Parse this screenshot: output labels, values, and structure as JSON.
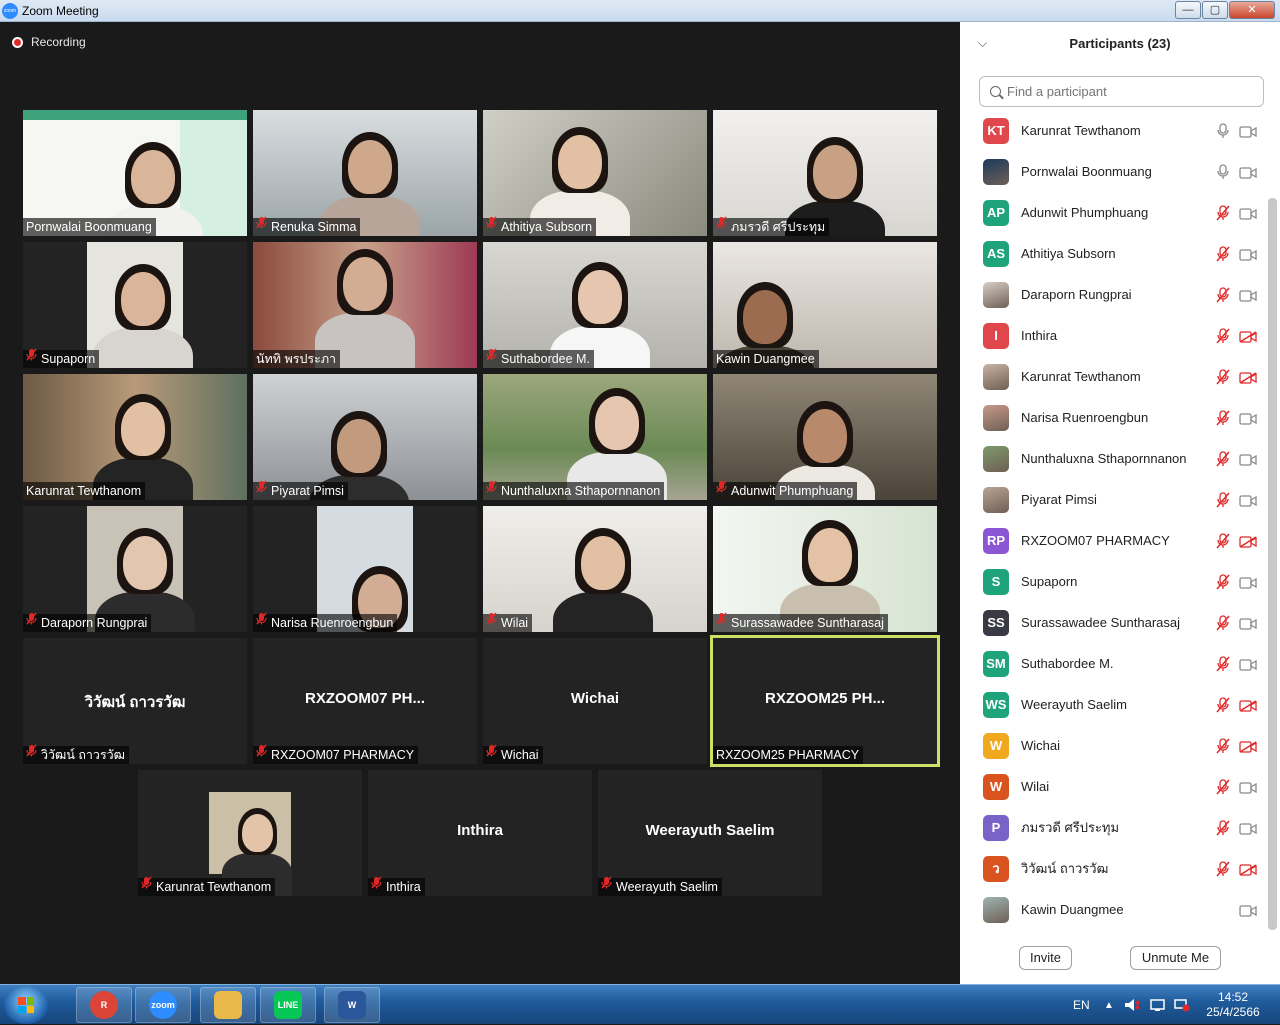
{
  "window": {
    "title": "Zoom Meeting",
    "minimize": "—",
    "maximize": "▢",
    "close": "✕"
  },
  "recording": {
    "label": "Recording"
  },
  "video_grid": {
    "tiles": [
      {
        "name": "Pornwalai Boonmuang",
        "muted": false
      },
      {
        "name": "Renuka Simma",
        "muted": true
      },
      {
        "name": "Athitiya Subsorn",
        "muted": true
      },
      {
        "name": "ภมรวดี ศรีประทุม",
        "muted": true
      },
      {
        "name": "Supaporn",
        "muted": true
      },
      {
        "name": "นัททิ พรประภา",
        "muted": false
      },
      {
        "name": "Suthabordee M.",
        "muted": true
      },
      {
        "name": "Kawin Duangmee",
        "muted": false
      },
      {
        "name": "Karunrat Tewthanom",
        "muted": false
      },
      {
        "name": "Piyarat Pimsi",
        "muted": true
      },
      {
        "name": "Nunthaluxna Sthapornnanon",
        "muted": true
      },
      {
        "name": "Adunwit Phumphuang",
        "muted": true
      },
      {
        "name": "Daraporn Rungprai",
        "muted": true
      },
      {
        "name": "Narisa Ruenroengbun",
        "muted": true
      },
      {
        "name": "Wilai",
        "muted": true
      },
      {
        "name": "Surassawadee Suntharasaj",
        "muted": true
      },
      {
        "name": "วิวัฒน์ ถาวรวัฒ",
        "display": "วิวัฒน์ ถาวรวัฒ",
        "muted": true
      },
      {
        "name": "RXZOOM07 PHARMACY",
        "display": "RXZOOM07  PH...",
        "muted": true
      },
      {
        "name": "Wichai",
        "display": "Wichai",
        "muted": true
      },
      {
        "name": "RXZOOM25 PHARMACY",
        "display": "RXZOOM25  PH...",
        "muted": false,
        "active": true
      },
      {
        "name": "Karunrat Tewthanom",
        "muted": true
      },
      {
        "name": "Inthira",
        "display": "Inthira",
        "muted": true
      },
      {
        "name": "Weerayuth Saelim",
        "display": "Weerayuth Saelim",
        "muted": true
      }
    ]
  },
  "participants_panel": {
    "title": "Participants (23)",
    "search_placeholder": "Find a participant",
    "participants": [
      {
        "initials": "KT",
        "name": "Karunrat Tewthanom",
        "color": "#e0474c",
        "mic": "on",
        "cam": "on"
      },
      {
        "initials": "",
        "name": "Pornwalai Boonmuang",
        "color": "#1b3a5c",
        "mic": "on",
        "cam": "on",
        "photo": true
      },
      {
        "initials": "AP",
        "name": "Adunwit Phumphuang",
        "color": "#1fa37a",
        "mic": "muted",
        "cam": "on"
      },
      {
        "initials": "AS",
        "name": "Athitiya Subsorn",
        "color": "#1fa37a",
        "mic": "muted",
        "cam": "on"
      },
      {
        "initials": "",
        "name": "Daraporn Rungprai",
        "color": "#d8cfc8",
        "mic": "muted",
        "cam": "on",
        "photo": true
      },
      {
        "initials": "I",
        "name": "Inthira",
        "color": "#e0474c",
        "mic": "muted",
        "cam": "off"
      },
      {
        "initials": "",
        "name": "Karunrat Tewthanom",
        "color": "#c9b3a3",
        "mic": "muted",
        "cam": "off",
        "photo": true
      },
      {
        "initials": "",
        "name": "Narisa Ruenroengbun",
        "color": "#c89a8a",
        "mic": "muted",
        "cam": "on",
        "photo": true
      },
      {
        "initials": "",
        "name": "Nunthaluxna Sthapornnanon",
        "color": "#7d9a6b",
        "mic": "muted",
        "cam": "on",
        "photo": true
      },
      {
        "initials": "",
        "name": "Piyarat Pimsi",
        "color": "#b9a596",
        "mic": "muted",
        "cam": "on",
        "photo": true
      },
      {
        "initials": "RP",
        "name": "RXZOOM07 PHARMACY",
        "color": "#8c55d4",
        "mic": "muted",
        "cam": "off"
      },
      {
        "initials": "S",
        "name": "Supaporn",
        "color": "#1fa37a",
        "mic": "muted",
        "cam": "on"
      },
      {
        "initials": "SS",
        "name": "Surassawadee Suntharasaj",
        "color": "#3a3a44",
        "mic": "muted",
        "cam": "on"
      },
      {
        "initials": "SM",
        "name": "Suthabordee M.",
        "color": "#1fa37a",
        "mic": "muted",
        "cam": "on"
      },
      {
        "initials": "WS",
        "name": "Weerayuth Saelim",
        "color": "#1fa37a",
        "mic": "muted",
        "cam": "off"
      },
      {
        "initials": "W",
        "name": "Wichai",
        "color": "#f0a81e",
        "mic": "muted",
        "cam": "off"
      },
      {
        "initials": "W",
        "name": "Wilai",
        "color": "#d9531e",
        "mic": "muted",
        "cam": "on"
      },
      {
        "initials": "P",
        "name": "ภมรวดี ศรีประทุม",
        "color": "#7b62c8",
        "mic": "muted",
        "cam": "on"
      },
      {
        "initials": "ว",
        "name": "วิวัฒน์ ถาวรวัฒ",
        "color": "#d9531e",
        "mic": "muted",
        "cam": "off"
      },
      {
        "initials": "",
        "name": "Kawin Duangmee",
        "color": "#9fb3b0",
        "mic": "none",
        "cam": "on",
        "photo": true
      }
    ],
    "invite_label": "Invite",
    "unmute_label": "Unmute Me"
  },
  "taskbar": {
    "apps": [
      {
        "name": "Chrome",
        "label": "R",
        "color": "#db4437"
      },
      {
        "name": "Zoom",
        "label": "zoom",
        "color": "#2d8cff"
      },
      {
        "name": "File Explorer",
        "label": "",
        "color": "#e8b84a"
      },
      {
        "name": "LINE",
        "label": "LINE",
        "color": "#06c755"
      },
      {
        "name": "Word",
        "label": "W",
        "color": "#2b579a"
      }
    ],
    "language": "EN",
    "time": "14:52",
    "date": "25/4/2566"
  }
}
